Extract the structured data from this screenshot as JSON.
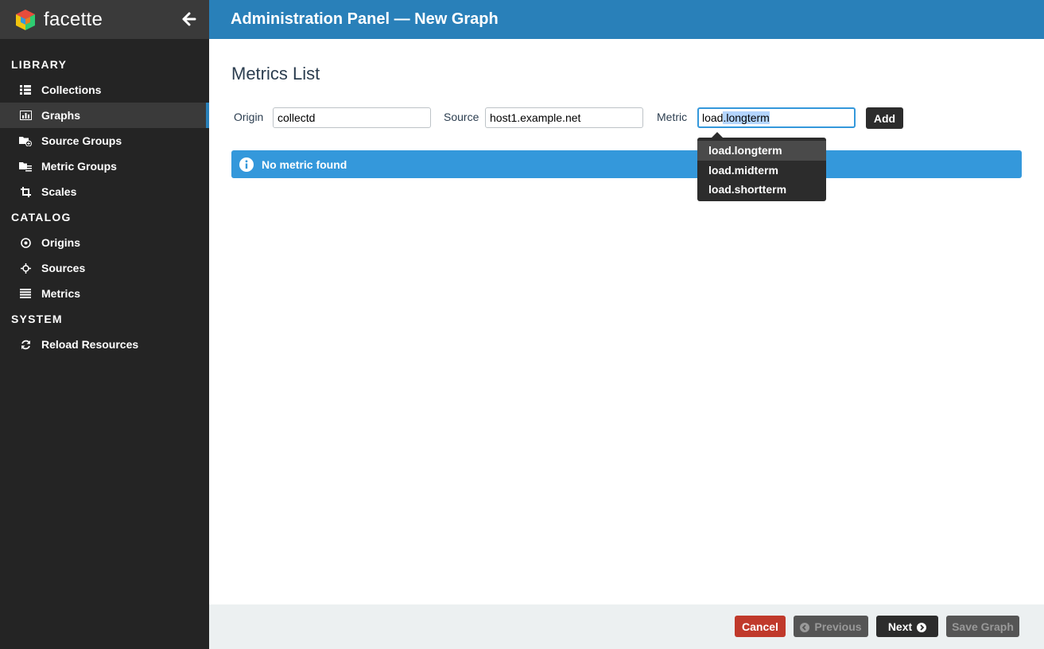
{
  "brand": {
    "name": "facette"
  },
  "sidebar": {
    "sections": [
      {
        "title": "LIBRARY"
      },
      {
        "title": "CATALOG"
      },
      {
        "title": "SYSTEM"
      }
    ],
    "items": [
      {
        "label": "Collections",
        "icon": "grid-icon"
      },
      {
        "label": "Graphs",
        "icon": "bar-chart-icon",
        "active": true
      },
      {
        "label": "Source Groups",
        "icon": "folder-plus-icon"
      },
      {
        "label": "Metric Groups",
        "icon": "folder-list-icon"
      },
      {
        "label": "Scales",
        "icon": "crop-icon"
      },
      {
        "label": "Origins",
        "icon": "dot-circle-icon"
      },
      {
        "label": "Sources",
        "icon": "crosshair-icon"
      },
      {
        "label": "Metrics",
        "icon": "list-icon"
      },
      {
        "label": "Reload Resources",
        "icon": "refresh-icon"
      }
    ]
  },
  "header": {
    "title": "Administration Panel — New Graph"
  },
  "main": {
    "title": "Metrics List",
    "origin_label": "Origin",
    "origin_value": "collectd",
    "source_label": "Source",
    "source_value": "host1.example.net",
    "metric_label": "Metric",
    "metric_typed": "load",
    "metric_selected": ".longterm",
    "add_label": "Add",
    "alert_text": "No metric found"
  },
  "autocomplete": {
    "options": [
      "load.longterm",
      "load.midterm",
      "load.shortterm"
    ],
    "highlighted": 0
  },
  "footer": {
    "cancel_label": "Cancel",
    "previous_label": "Previous",
    "next_label": "Next",
    "save_label": "Save Graph"
  },
  "colors": {
    "header": "#2980b9",
    "sidebar": "#242424",
    "alert": "#3498db",
    "cancel": "#c0392b"
  }
}
